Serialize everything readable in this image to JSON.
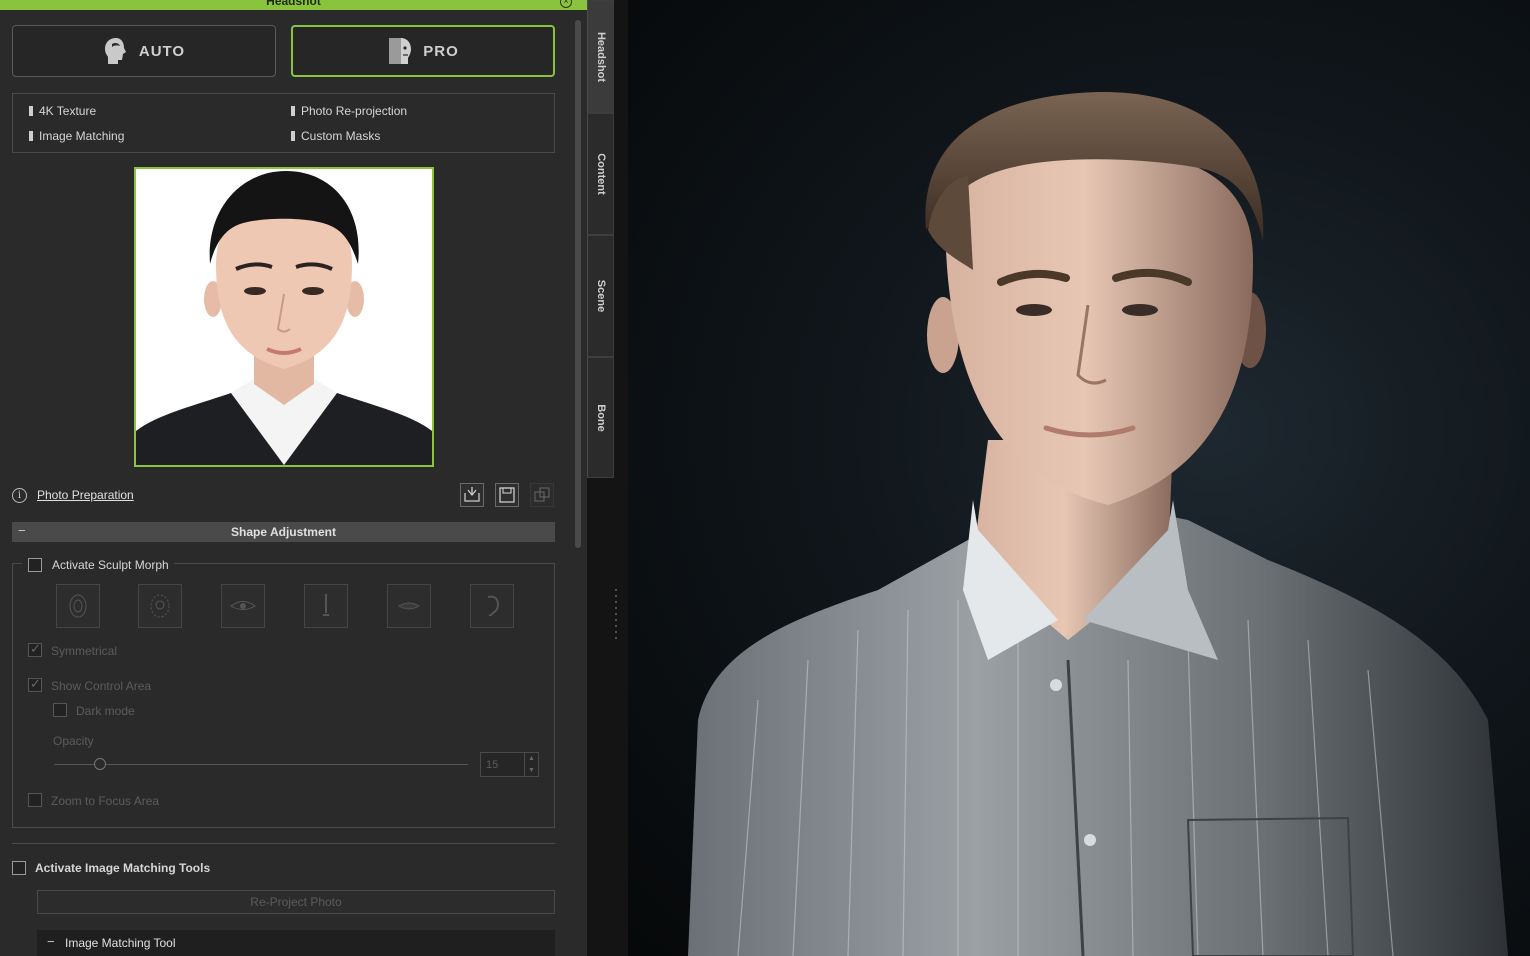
{
  "panel": {
    "title": "Headshot",
    "modes": {
      "auto": "AUTO",
      "pro": "PRO",
      "active": "PRO"
    },
    "features": [
      "4K Texture",
      "Photo Re-projection",
      "Image Matching",
      "Custom Masks"
    ],
    "photo_preparation": "Photo Preparation",
    "shape_adjustment": {
      "header": "Shape Adjustment",
      "activate_sculpt_morph": "Activate Sculpt Morph",
      "morph_icons": [
        "full-face-icon",
        "head-outline-icon",
        "eye-icon",
        "nose-icon",
        "mouth-icon",
        "ear-icon"
      ],
      "symmetrical": "Symmetrical",
      "show_control_area": "Show Control Area",
      "dark_mode": "Dark mode",
      "opacity_label": "Opacity",
      "opacity_value": "15",
      "opacity_fraction": 0.15,
      "zoom_to_focus_area": "Zoom to Focus Area"
    },
    "activate_image_matching_tools": "Activate Image Matching Tools",
    "reproject_photo": "Re-Project Photo",
    "image_matching_tool": "Image Matching Tool"
  },
  "tabs": [
    "Headshot",
    "Content",
    "Scene",
    "Bone"
  ],
  "active_tab": "Headshot",
  "colors": {
    "accent": "#8ac43f",
    "panel_bg": "#2a2a2a",
    "viewport_bg": "#0f151a"
  }
}
